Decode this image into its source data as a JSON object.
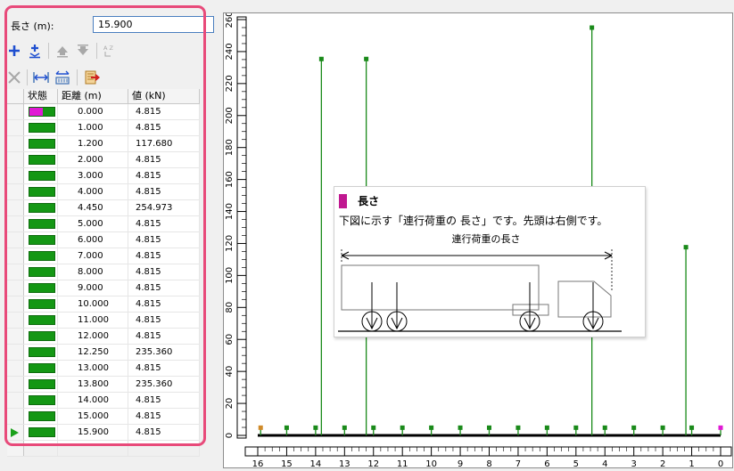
{
  "length": {
    "label": "長さ (m):",
    "value": "15.900"
  },
  "toolbar": {
    "row1": [
      {
        "name": "add-icon",
        "enabled": true
      },
      {
        "name": "insert-icon",
        "enabled": true
      },
      {
        "name": "move-up-icon",
        "enabled": false
      },
      {
        "name": "move-down-icon",
        "enabled": false
      },
      {
        "name": "sort-icon",
        "enabled": false
      }
    ],
    "row2": [
      {
        "name": "delete-icon",
        "enabled": false
      },
      {
        "name": "equal-spacing-icon",
        "enabled": true
      },
      {
        "name": "numbering-icon",
        "enabled": true
      },
      {
        "name": "export-icon",
        "enabled": true
      }
    ],
    "sort_icon_text": "A Z"
  },
  "table": {
    "columns": [
      "状態",
      "距離 (m)",
      "値 (kN)"
    ],
    "rows": [
      {
        "distance": "0.000",
        "value": "4.815"
      },
      {
        "distance": "1.000",
        "value": "4.815"
      },
      {
        "distance": "1.200",
        "value": "117.680"
      },
      {
        "distance": "2.000",
        "value": "4.815"
      },
      {
        "distance": "3.000",
        "value": "4.815"
      },
      {
        "distance": "4.000",
        "value": "4.815"
      },
      {
        "distance": "4.450",
        "value": "254.973"
      },
      {
        "distance": "5.000",
        "value": "4.815"
      },
      {
        "distance": "6.000",
        "value": "4.815"
      },
      {
        "distance": "7.000",
        "value": "4.815"
      },
      {
        "distance": "8.000",
        "value": "4.815"
      },
      {
        "distance": "9.000",
        "value": "4.815"
      },
      {
        "distance": "10.000",
        "value": "4.815"
      },
      {
        "distance": "11.000",
        "value": "4.815"
      },
      {
        "distance": "12.000",
        "value": "4.815"
      },
      {
        "distance": "12.250",
        "value": "235.360"
      },
      {
        "distance": "13.000",
        "value": "4.815"
      },
      {
        "distance": "13.800",
        "value": "235.360"
      },
      {
        "distance": "14.000",
        "value": "4.815"
      },
      {
        "distance": "15.000",
        "value": "4.815"
      },
      {
        "distance": "15.900",
        "value": "4.815"
      }
    ],
    "highlighted_row": 0,
    "current_row": 20
  },
  "chart_data": {
    "type": "bar",
    "x": [
      0,
      1,
      1.2,
      2,
      3,
      4,
      4.45,
      5,
      6,
      7,
      8,
      9,
      10,
      11,
      12,
      12.25,
      13,
      13.8,
      14,
      15,
      15.9
    ],
    "values": [
      4.815,
      4.815,
      117.68,
      4.815,
      4.815,
      4.815,
      254.973,
      4.815,
      4.815,
      4.815,
      4.815,
      4.815,
      4.815,
      4.815,
      4.815,
      235.36,
      4.815,
      235.36,
      4.815,
      4.815,
      4.815
    ],
    "xlim": [
      16,
      0
    ],
    "ylim": [
      0,
      260
    ],
    "xticks": [
      16,
      15,
      14,
      13,
      12,
      11,
      10,
      9,
      8,
      7,
      6,
      5,
      4,
      3,
      2,
      1,
      0
    ],
    "yticks": [
      0,
      20,
      40,
      60,
      80,
      100,
      120,
      140,
      160,
      180,
      200,
      220,
      240,
      260
    ],
    "xaxis_direction": "reversed",
    "grid": false,
    "colors": {
      "bar": "#1a8a1a",
      "marker": "#1a8a1a",
      "origin_marker": "#e019d4",
      "end_marker": "#d08a2a"
    }
  },
  "tooltip": {
    "title": "長さ",
    "description": "下図に示す「連行荷重の 長さ」です。先頭は右側です。",
    "diagram_label": "連行荷重の長さ",
    "swatch_color": "#c01890"
  },
  "colors": {
    "status_green": "#149714",
    "status_magenta": "#e019d4",
    "highlight_border": "#e84a7a",
    "input_border": "#4a7ebf"
  }
}
